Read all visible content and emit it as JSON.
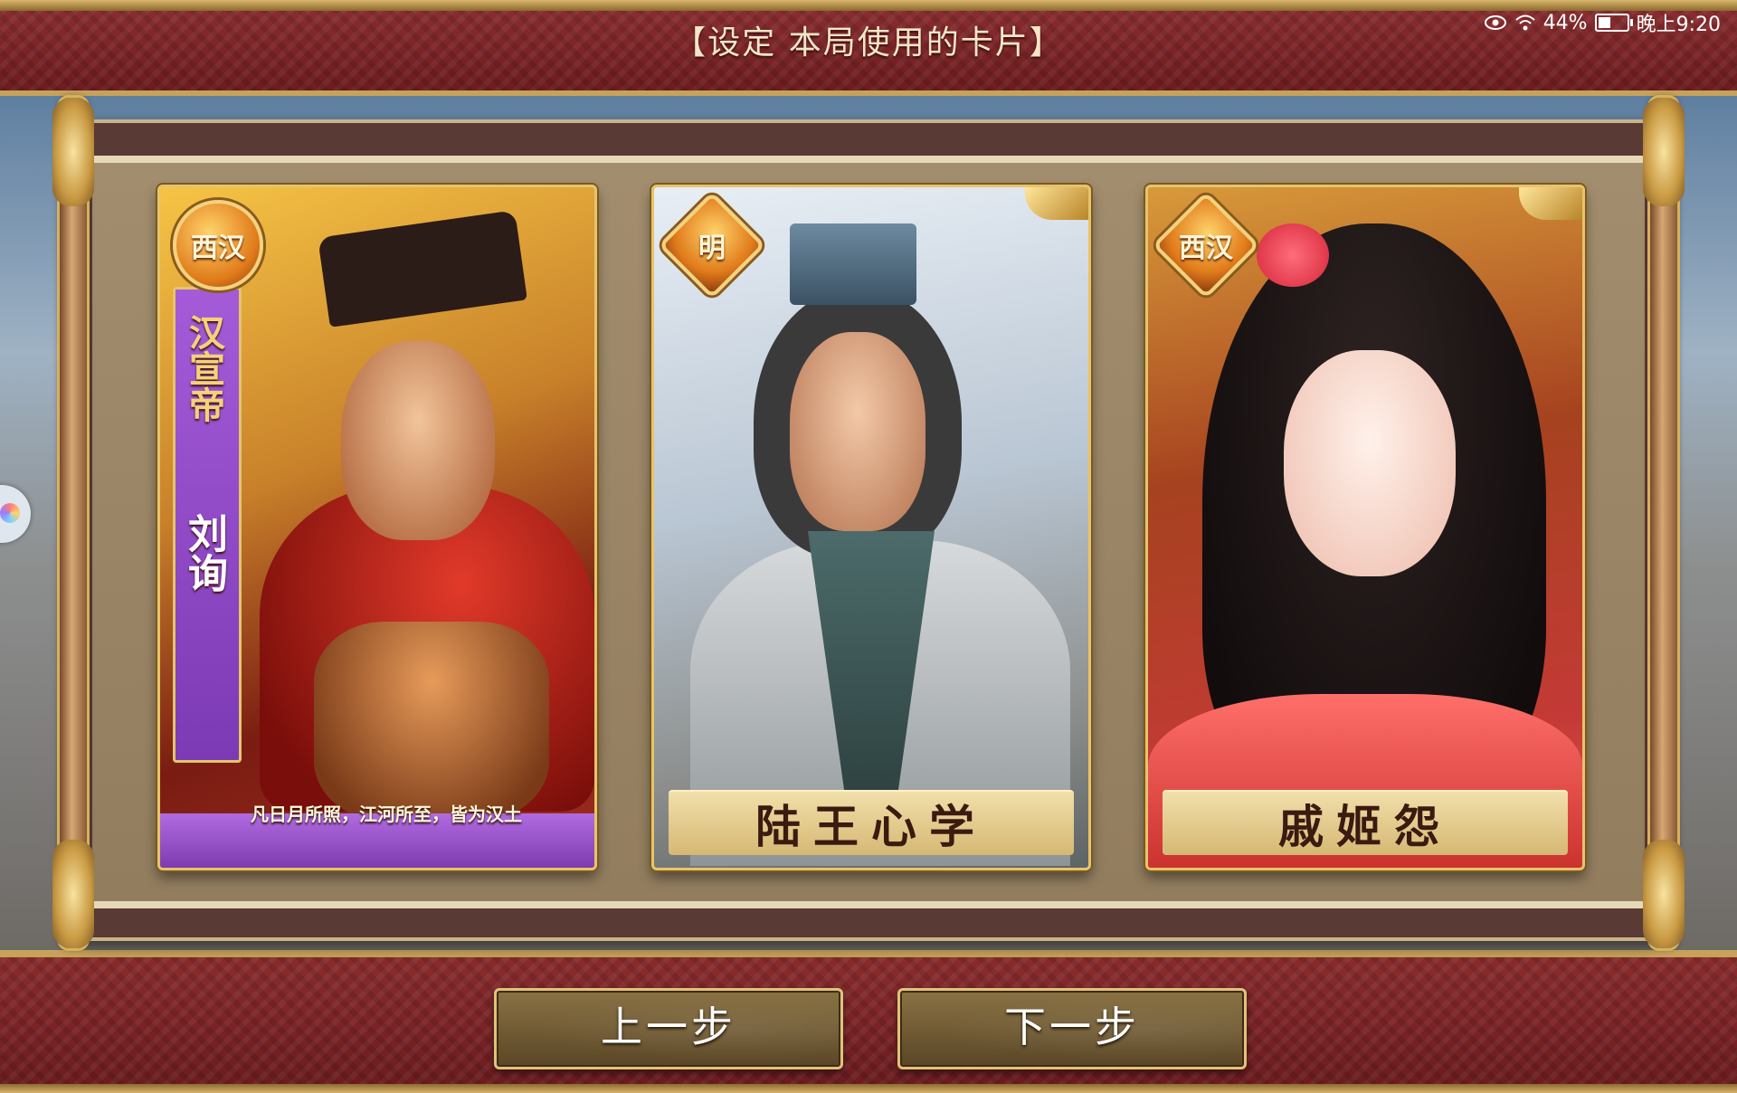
{
  "header": {
    "title": "【设定 本局使用的卡片】"
  },
  "status_bar": {
    "battery_percent": "44%",
    "battery_level": 0.44,
    "time": "晚上9:20",
    "icons": [
      "eye-icon",
      "wifi-icon",
      "battery-icon"
    ]
  },
  "cards": [
    {
      "badge": "西汉",
      "name_vertical_1": "汉宣帝",
      "name_vertical_2": "刘询",
      "motto": "凡日月所照，江河所至，皆为汉土",
      "title": ""
    },
    {
      "badge": "明",
      "title": "陆王心学"
    },
    {
      "badge": "西汉",
      "title": "戚姬怨"
    }
  ],
  "buttons": {
    "prev_label": "上一步",
    "next_label": "下一步"
  },
  "colors": {
    "band": "#7a2426",
    "gold": "#e0c27a",
    "panel": "#9e8a69"
  }
}
